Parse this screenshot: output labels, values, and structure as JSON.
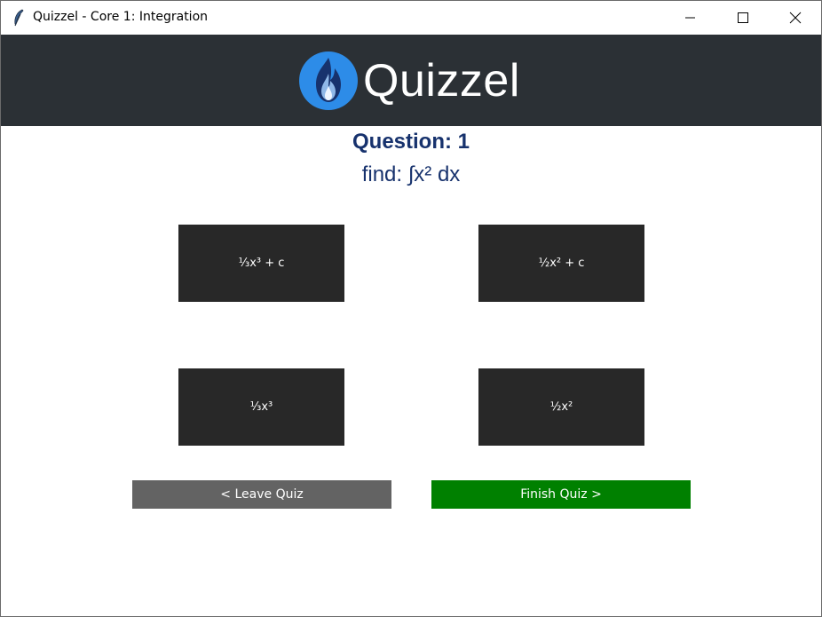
{
  "window": {
    "title": "Quizzel - Core 1: Integration",
    "icon": "feather-icon",
    "controls": [
      "minimize-icon",
      "maximize-icon",
      "close-icon"
    ]
  },
  "header": {
    "logo_icon": "flame-icon",
    "brand": "Quizzel",
    "colors": {
      "banner": "#2b3035",
      "logo_circle": "#2d8ce8"
    }
  },
  "question": {
    "number_label": "Question: 1",
    "text": "find: ∫x² dx",
    "color": "#17326d"
  },
  "answers": [
    "⅓x³ + c",
    "½x² + c",
    "⅓x³",
    "½x²"
  ],
  "footer": {
    "leave_label": "< Leave Quiz",
    "finish_label": "Finish Quiz >",
    "colors": {
      "leave": "#636363",
      "finish": "#008000"
    }
  }
}
